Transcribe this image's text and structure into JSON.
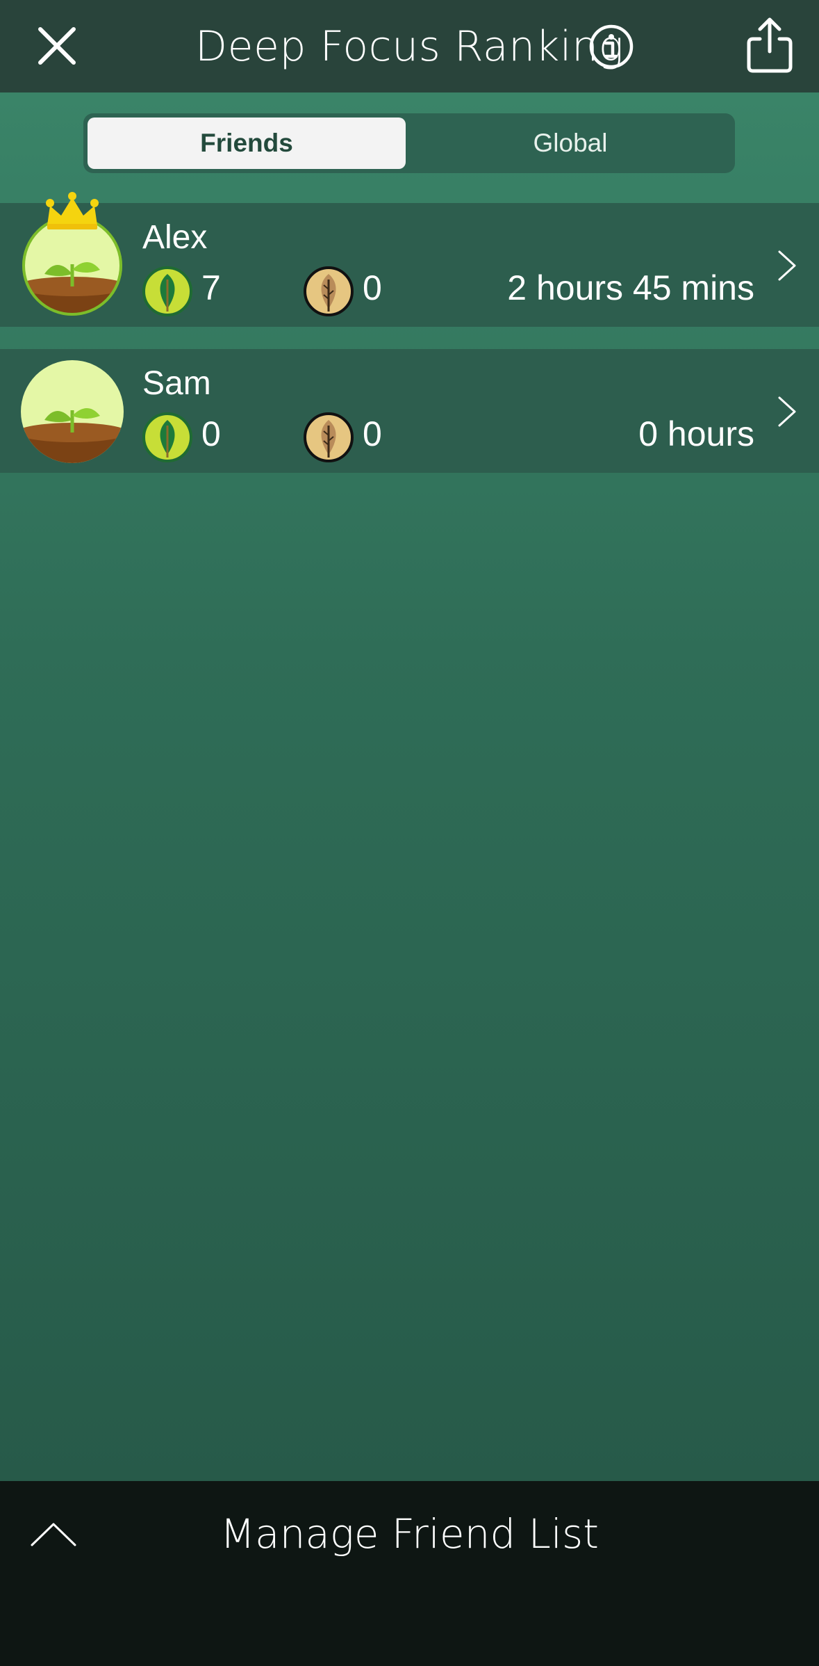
{
  "header": {
    "title": "Deep Focus Ranking",
    "close_icon": "close-icon",
    "info_icon": "info-icon",
    "share_icon": "share-icon"
  },
  "tabs": {
    "items": [
      {
        "label": "Friends",
        "selected": true
      },
      {
        "label": "Global",
        "selected": false
      }
    ]
  },
  "friends": [
    {
      "name": "Alex",
      "live_trees": "7",
      "dead_trees": "0",
      "focus_time": "2 hours 45 mins",
      "crown": true
    },
    {
      "name": "Sam",
      "live_trees": "0",
      "dead_trees": "0",
      "focus_time": "0 hours",
      "crown": false
    }
  ],
  "footer": {
    "label": "Manage Friend List",
    "icon": "chevron-up-icon"
  },
  "colors": {
    "header_bg": "#29443b",
    "row_bg": "#2d5e4e",
    "main_top": "#3a8468",
    "main_bottom": "#275a49",
    "footer_bg": "#0e1613",
    "crown": "#f5d40f",
    "sprout": "#7cbd2a"
  }
}
